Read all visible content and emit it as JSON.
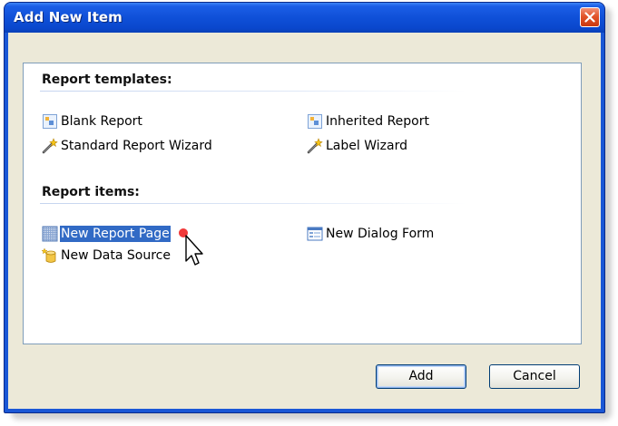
{
  "window": {
    "title": "Add New Item"
  },
  "report_templates": {
    "header": "Report templates:",
    "items": [
      {
        "label": "Blank Report",
        "icon": "blank-report-icon"
      },
      {
        "label": "Inherited Report",
        "icon": "inherited-report-icon"
      },
      {
        "label": "Standard Report Wizard",
        "icon": "wizard-wand-icon"
      },
      {
        "label": "Label Wizard",
        "icon": "wizard-wand-icon"
      }
    ]
  },
  "report_items": {
    "header": "Report items:",
    "items": [
      {
        "label": "New Report Page",
        "icon": "report-page-icon",
        "selected": true
      },
      {
        "label": "New Dialog Form",
        "icon": "dialog-form-icon"
      },
      {
        "label": "New Data Source",
        "icon": "data-source-icon"
      }
    ]
  },
  "buttons": {
    "add": "Add",
    "cancel": "Cancel"
  },
  "colors": {
    "titlebar": "#0f50d8",
    "selection": "#316ac5",
    "dialog_background": "#ece9d8",
    "close_button": "#e2542a"
  }
}
